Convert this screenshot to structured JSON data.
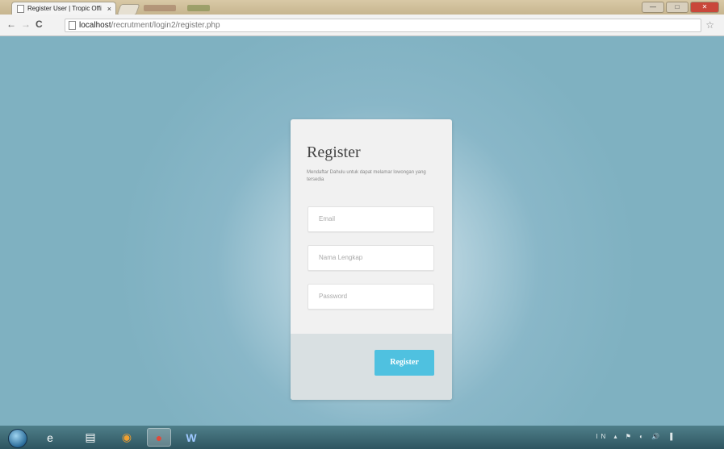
{
  "browser": {
    "tab_title": "Register User | Tropic Offi",
    "tab_close": "×",
    "url_host": "localhost",
    "url_path": "/recrutment/login2/register.php",
    "back": "←",
    "forward": "→",
    "reload": "C",
    "bookmark_star": "☆"
  },
  "window_controls": {
    "minimize": "—",
    "maximize": "□",
    "close": "✕"
  },
  "form": {
    "title": "Register",
    "subtitle": "Mendaftar Dahulu untuk dapat melamar lowongan yang tersedia",
    "email_placeholder": "Email",
    "name_placeholder": "Nama Lengkap",
    "password_placeholder": "Password",
    "submit_label": "Register"
  },
  "taskbar": {
    "items": [
      {
        "icon": "ie-icon",
        "glyph": "e"
      },
      {
        "icon": "folder-icon",
        "glyph": "▤"
      },
      {
        "icon": "media-player-icon",
        "glyph": "◉"
      },
      {
        "icon": "chrome-icon",
        "glyph": "●"
      },
      {
        "icon": "word-icon",
        "glyph": "W"
      }
    ],
    "tray_text": "IN ▴ ⚑ ◐ 🔊 ▐"
  },
  "colors": {
    "page_background": "#7fb1c1",
    "button": "#4fc1e0",
    "card": "#f1f1f1",
    "card_footer": "#d9e0e2"
  }
}
